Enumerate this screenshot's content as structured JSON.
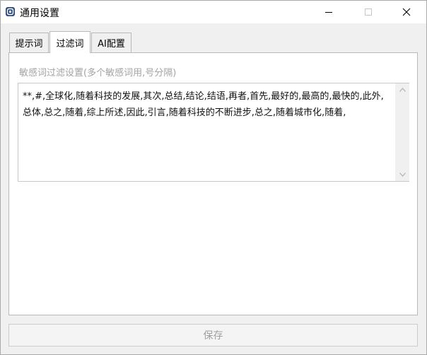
{
  "window": {
    "title": "通用设置"
  },
  "tabs": [
    {
      "label": "提示词",
      "active": false
    },
    {
      "label": "过滤词",
      "active": true
    },
    {
      "label": "AI配置",
      "active": false
    }
  ],
  "filter": {
    "section_label": "敏感词过滤设置(多个敏感词用,号分隔)",
    "words_value": "**,#,全球化,随着科技的发展,其次,总结,结论,结语,再者,首先,最好的,最高的,最快的,此外,总体,总之,随着,综上所述,因此,引言,随着科技的不断进步,总之,随着城市化,随着,"
  },
  "footer": {
    "save_label": "保存",
    "save_enabled": false
  },
  "colors": {
    "app_icon_bg": "#2f4c7e",
    "disabled_text": "#a0a0a0"
  }
}
